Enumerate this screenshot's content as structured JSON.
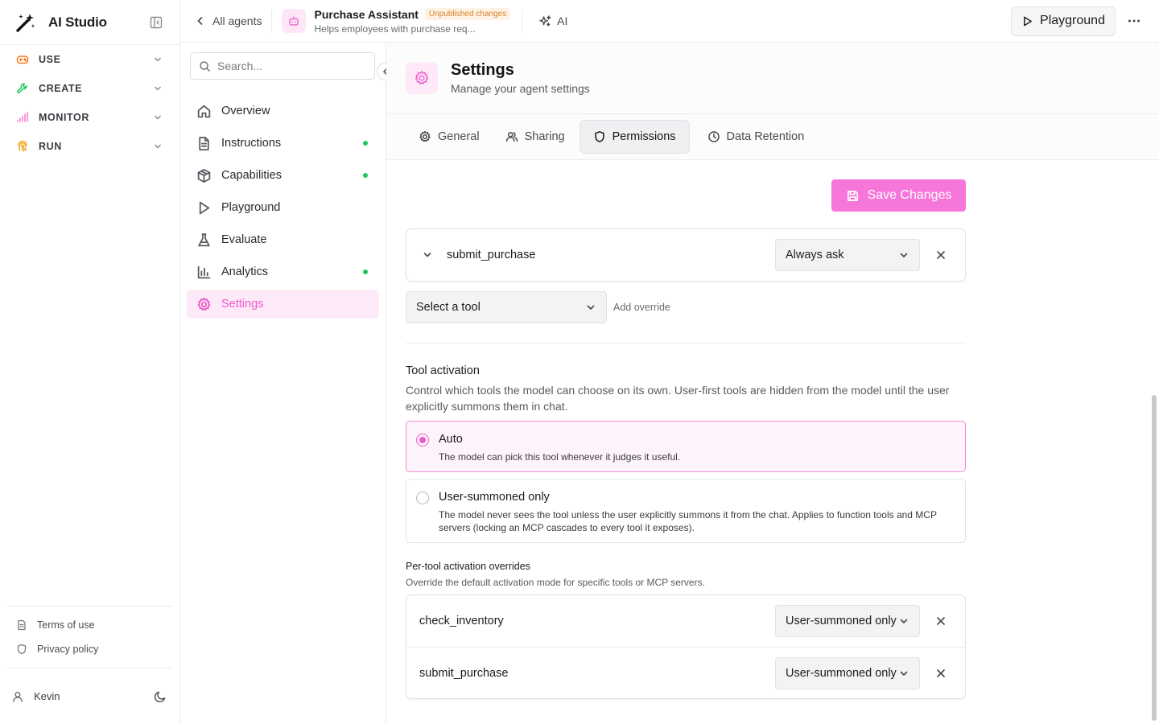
{
  "app": {
    "name": "AI Studio"
  },
  "global_nav": [
    {
      "label": "USE",
      "icon": "gamepad-icon",
      "color": "#f97316"
    },
    {
      "label": "CREATE",
      "icon": "wrench-icon",
      "color": "#22c55e"
    },
    {
      "label": "MONITOR",
      "icon": "signal-icon",
      "color": "#f472d0"
    },
    {
      "label": "RUN",
      "icon": "fingerprint-icon",
      "color": "#f59e0b"
    }
  ],
  "footer": {
    "terms": "Terms of use",
    "privacy": "Privacy policy",
    "user": "Kevin"
  },
  "topbar": {
    "back_label": "All agents",
    "agent_name": "Purchase Assistant",
    "badge": "Unpublished changes",
    "agent_desc": "Helps employees with purchase req...",
    "ai_label": "AI",
    "playground_label": "Playground"
  },
  "agent_nav": {
    "search_placeholder": "Search...",
    "items": [
      {
        "label": "Overview",
        "dot": false
      },
      {
        "label": "Instructions",
        "dot": true
      },
      {
        "label": "Capabilities",
        "dot": true
      },
      {
        "label": "Playground",
        "dot": false
      },
      {
        "label": "Evaluate",
        "dot": false
      },
      {
        "label": "Analytics",
        "dot": true
      },
      {
        "label": "Settings",
        "dot": false,
        "active": true
      }
    ]
  },
  "page": {
    "title": "Settings",
    "subtitle": "Manage your agent settings",
    "tabs": [
      {
        "label": "General"
      },
      {
        "label": "Sharing"
      },
      {
        "label": "Permissions",
        "active": true
      },
      {
        "label": "Data Retention"
      }
    ],
    "save_label": "Save Changes"
  },
  "permissions": {
    "override": {
      "tool": "submit_purchase",
      "value": "Always ask"
    },
    "select_placeholder": "Select a tool",
    "add_override": "Add override"
  },
  "activation": {
    "title": "Tool activation",
    "description": "Control which tools the model can choose on its own. User-first tools are hidden from the model until the user explicitly summons them in chat.",
    "options": [
      {
        "title": "Auto",
        "desc": "The model can pick this tool whenever it judges it useful.",
        "selected": true
      },
      {
        "title": "User-summoned only",
        "desc": "The model never sees the tool unless the user explicitly summons it from the chat. Applies to function tools and MCP servers (locking an MCP cascades to every tool it exposes).",
        "selected": false
      }
    ],
    "overrides_title": "Per-tool activation overrides",
    "overrides_desc": "Override the default activation mode for specific tools or MCP servers.",
    "overrides": [
      {
        "tool": "check_inventory",
        "value": "User-summoned only"
      },
      {
        "tool": "submit_purchase",
        "value": "User-summoned only"
      }
    ]
  },
  "colors": {
    "accent": "#f776d9",
    "accent_soft": "#fde9f8",
    "dot": "#22c55e",
    "badge": "#d9822b"
  }
}
